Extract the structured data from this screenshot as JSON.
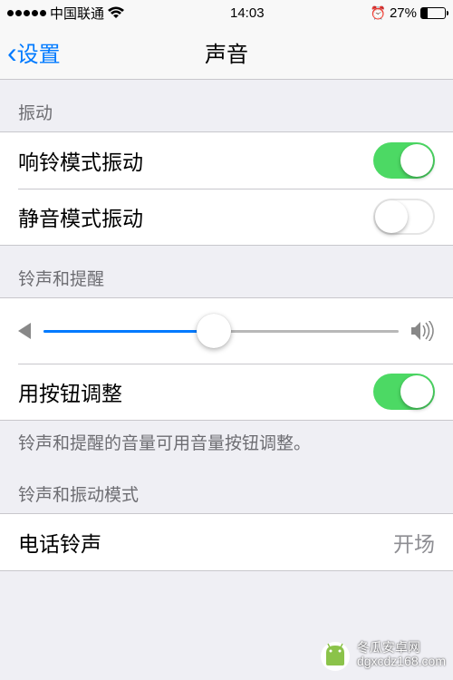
{
  "status": {
    "carrier": "中国联通",
    "time": "14:03",
    "battery_pct": "27%"
  },
  "nav": {
    "back_label": "设置",
    "title": "声音"
  },
  "sections": {
    "vibrate": {
      "header": "振动",
      "ring_vibrate_label": "响铃模式振动",
      "ring_vibrate_on": true,
      "silent_vibrate_label": "静音模式振动",
      "silent_vibrate_on": false
    },
    "ringer": {
      "header": "铃声和提醒",
      "volume_percent": 48,
      "buttons_label": "用按钮调整",
      "buttons_on": true,
      "footer": "铃声和提醒的音量可用音量按钮调整。"
    },
    "patterns": {
      "header": "铃声和振动模式",
      "ringtone_label": "电话铃声",
      "ringtone_value": "开场"
    }
  },
  "watermark": {
    "line1": "冬瓜安卓网",
    "line2": "dgxcdz168.com"
  }
}
